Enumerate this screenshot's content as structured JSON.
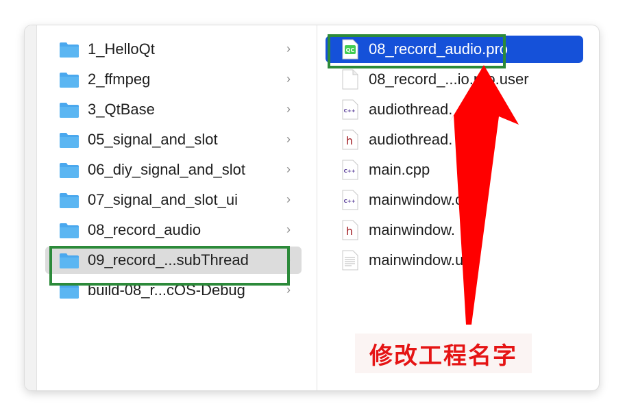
{
  "left_column": {
    "items": [
      {
        "label": "1_HelloQt"
      },
      {
        "label": "2_ffmpeg"
      },
      {
        "label": "3_QtBase"
      },
      {
        "label": "05_signal_and_slot"
      },
      {
        "label": "06_diy_signal_and_slot"
      },
      {
        "label": "07_signal_and_slot_ui"
      },
      {
        "label": "08_record_audio"
      },
      {
        "label": "09_record_...subThread"
      },
      {
        "label": "build-08_r...cOS-Debug"
      }
    ],
    "chevron": "›"
  },
  "right_column": {
    "items": [
      {
        "label": "08_record_audio.pro",
        "icon": "qt-project-icon"
      },
      {
        "label": "08_record_...io.pro.user",
        "icon": "blank-file-icon"
      },
      {
        "label": "audiothread.",
        "icon": "cpp-file-icon",
        "badge": "C++"
      },
      {
        "label": "audiothread.",
        "icon": "header-file-icon",
        "badge": "h"
      },
      {
        "label": "main.cpp",
        "icon": "cpp-file-icon",
        "badge": "C++"
      },
      {
        "label": "mainwindow.cpp",
        "icon": "cpp-file-icon",
        "badge": "C++"
      },
      {
        "label": "mainwindow.",
        "icon": "header-file-icon",
        "badge": "h"
      },
      {
        "label": "mainwindow.ui",
        "icon": "ui-file-icon"
      }
    ]
  },
  "annotation": {
    "text": "修改工程名字",
    "color": "#e51414"
  },
  "colors": {
    "selection_blue": "#1551d9",
    "selection_gray": "#dcdcdc",
    "highlight_green": "#2c8a3a",
    "folder_blue": "#5bb6f2"
  }
}
